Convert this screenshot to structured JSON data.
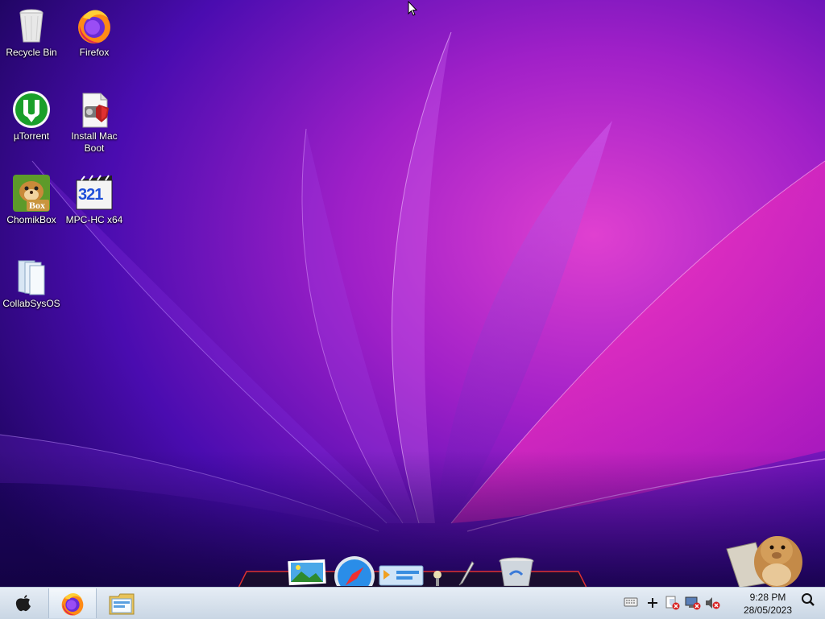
{
  "desktop": {
    "icons": [
      {
        "label": "Recycle Bin"
      },
      {
        "label": "Firefox"
      },
      {
        "label": "µTorrent"
      },
      {
        "label": "Install Mac Boot"
      },
      {
        "label": "ChomikBox"
      },
      {
        "label": "MPC-HC x64"
      },
      {
        "label": "CollabSysOS"
      }
    ],
    "chomikbox_badge": "Box",
    "mpc_badge": "321"
  },
  "taskbar": {
    "time": "9:28 PM",
    "date": "28/05/2023"
  },
  "colors": {
    "wallpaper_magenta": "#e020b8",
    "wallpaper_purple": "#7a18c8",
    "wallpaper_dark": "#1a0550",
    "taskbar_bg": "#d6e1ec"
  }
}
